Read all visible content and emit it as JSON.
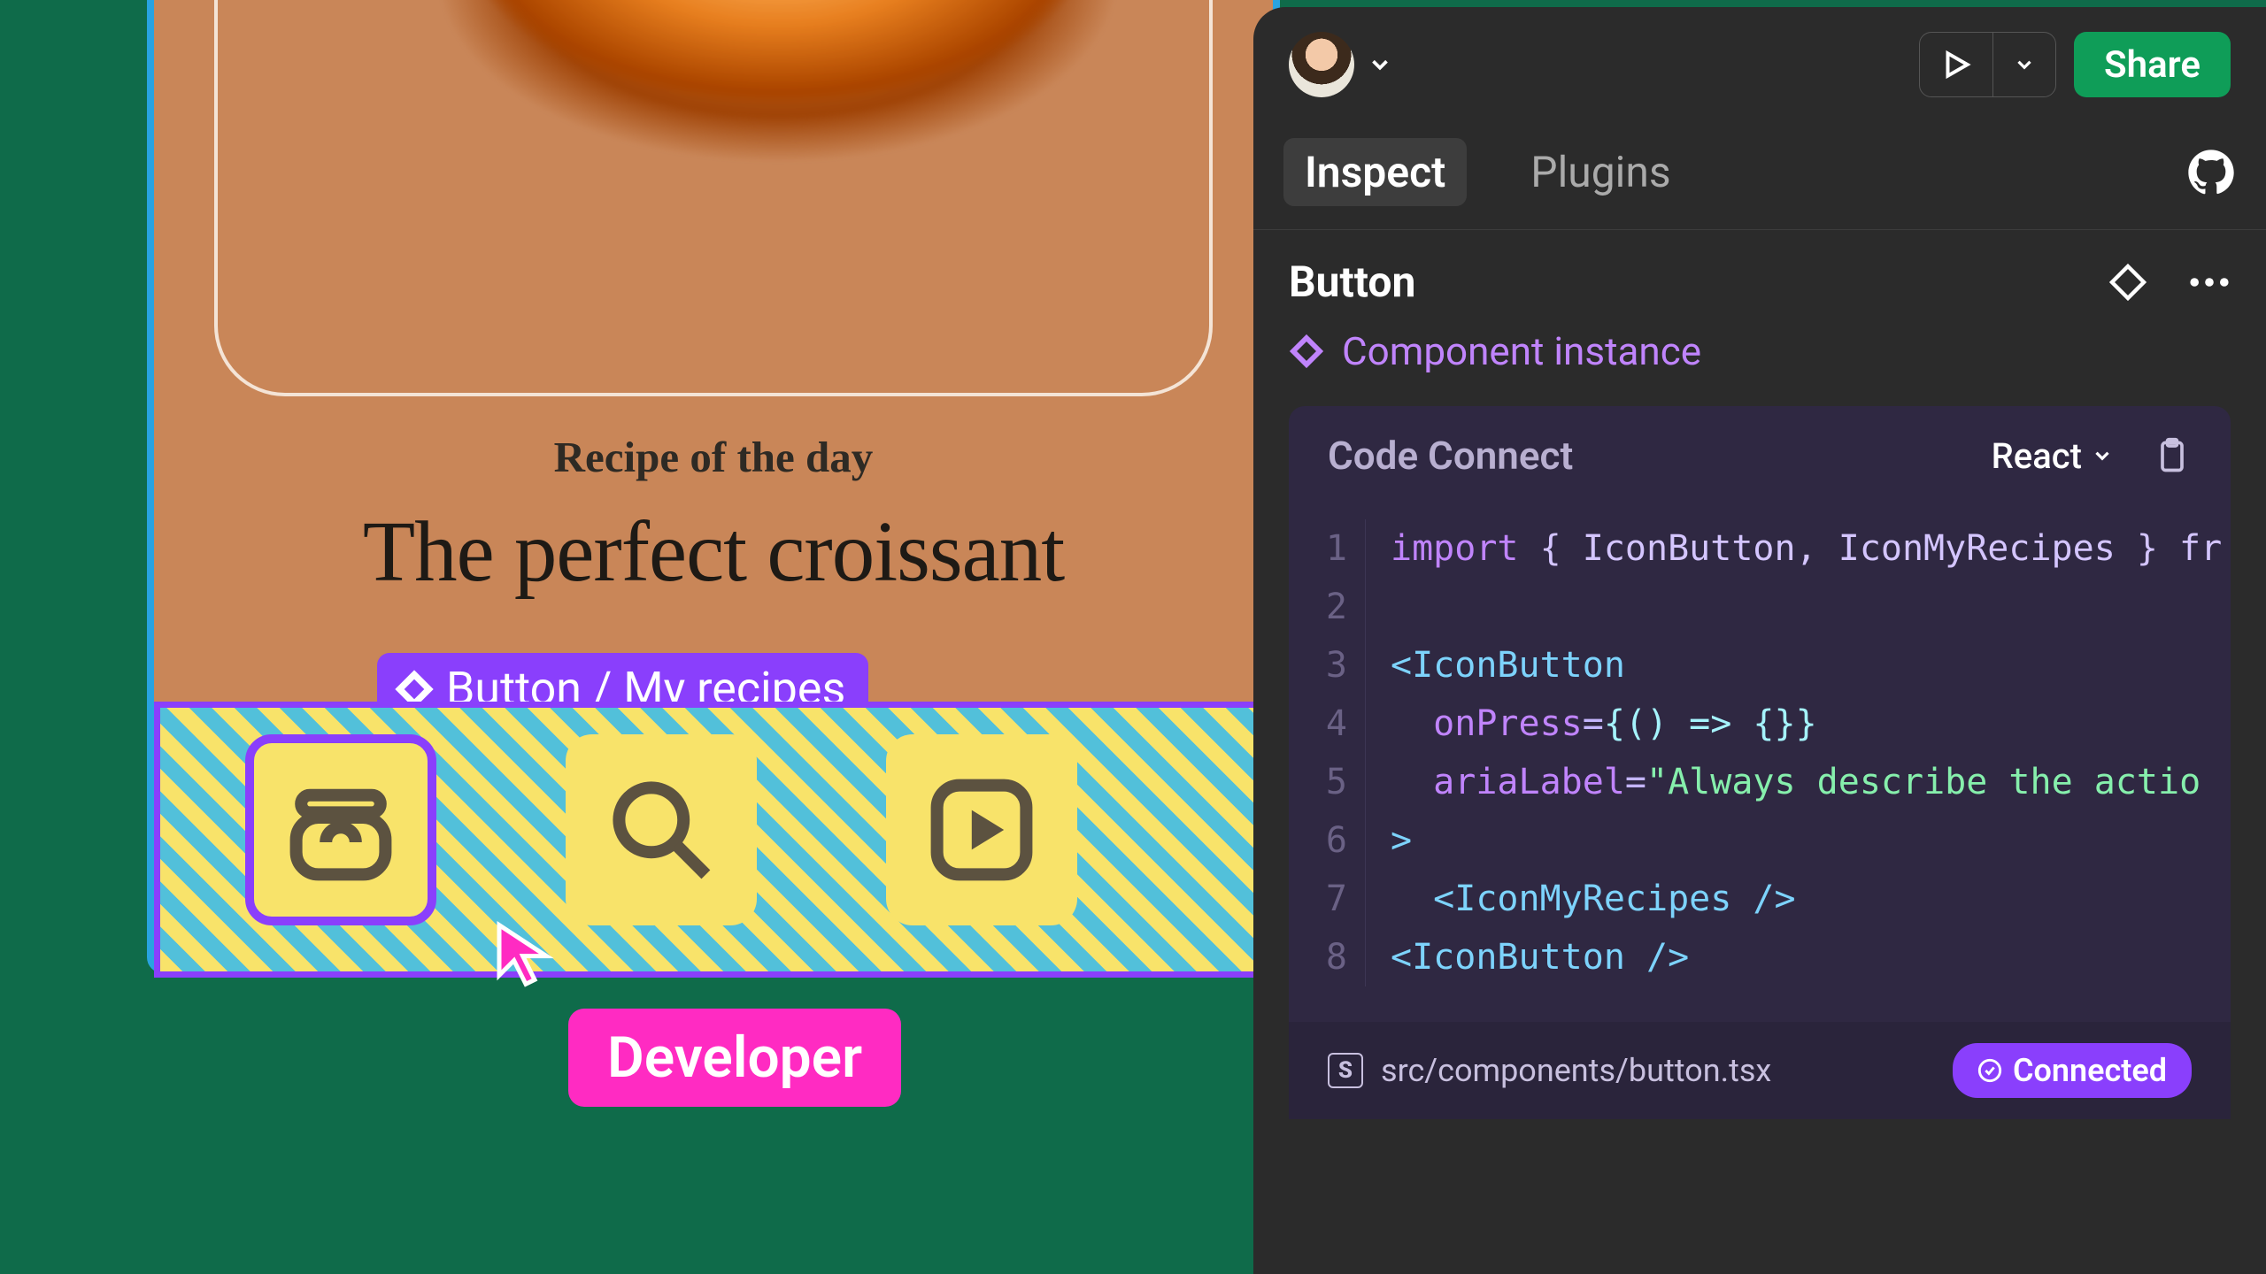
{
  "canvas": {
    "subtitle": "Recipe of the day",
    "title": "The perfect croissant",
    "component_label": "Button / My recipes",
    "dev_badge": "Developer",
    "nav_icons": [
      "recipes-icon",
      "search-icon",
      "play-icon"
    ]
  },
  "panel": {
    "share_label": "Share",
    "tabs": {
      "inspect": "Inspect",
      "plugins": "Plugins"
    },
    "section_title": "Button",
    "instance_label": "Component instance",
    "code": {
      "header": "Code Connect",
      "framework": "React",
      "lines": {
        "l1_kw": "import",
        "l1_rest": " { IconButton, IconMyRecipes } fr",
        "l3": "<IconButton",
        "l4_attr": "onPress",
        "l4_val": "{() => {}}",
        "l5_attr": "ariaLabel",
        "l5_eq": "=",
        "l5_str": "\"Always describe the actio",
        "l6": ">",
        "l7": "  <IconMyRecipes />",
        "l8": "<IconButton />"
      },
      "line_numbers": [
        "1",
        "2",
        "3",
        "4",
        "5",
        "6",
        "7",
        "8"
      ],
      "file": "src/components/button.tsx",
      "connected": "Connected",
      "s_badge": "S"
    }
  }
}
